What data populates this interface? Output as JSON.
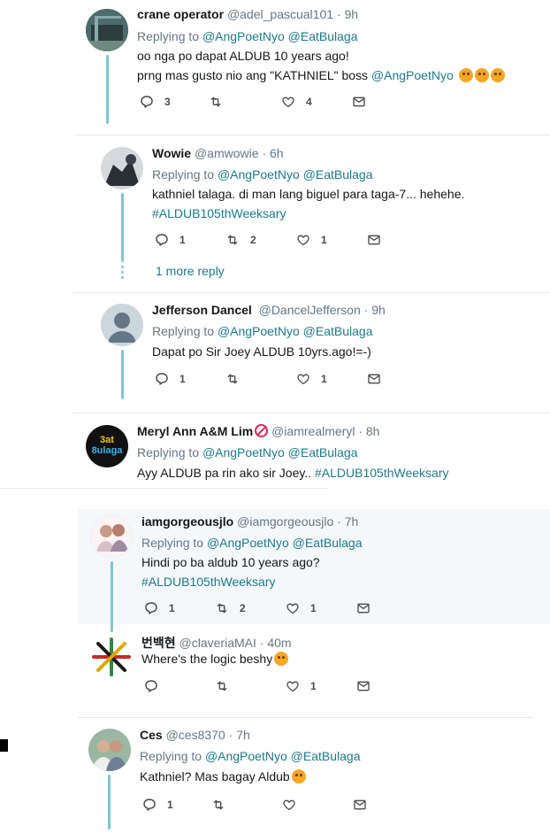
{
  "tweets": [
    {
      "name": "crane operator",
      "handle": "@adel_pascual101",
      "sep": "·",
      "time": "9h",
      "replying_prefix": "Replying to",
      "reply_to": [
        "@AngPoetNyo",
        "@EatBulaga"
      ],
      "text_lines": [
        "oo nga po dapat ALDUB 10 years ago!",
        "prng mas gusto nio ang \"KATHNIEL\" boss"
      ],
      "inline_mention": "@AngPoetNyo",
      "emojis": [
        "persevering-face",
        "persevering-face",
        "persevering-face"
      ],
      "reply_count": "3",
      "retweet_count": "",
      "like_count": "4"
    },
    {
      "name": "Wowie",
      "handle": "@amwowie",
      "sep": "·",
      "time": "6h",
      "replying_prefix": "Replying to",
      "reply_to": [
        "@AngPoetNyo",
        "@EatBulaga"
      ],
      "text_lines": [
        "kathniel talaga. di man lang biguel para taga-7... hehehe."
      ],
      "hashtag": "#ALDUB105thWeeksary",
      "reply_count": "1",
      "retweet_count": "2",
      "like_count": "1",
      "more_reply": "1 more reply"
    },
    {
      "name": "Jefferson Dancel",
      "handle": "@DancelJefferson",
      "sep": "·",
      "time": "9h",
      "replying_prefix": "Replying to",
      "reply_to": [
        "@AngPoetNyo",
        "@EatBulaga"
      ],
      "text_lines": [
        "Dapat po Sir Joey ALDUB 10yrs.ago!=-)"
      ],
      "reply_count": "1",
      "retweet_count": "",
      "like_count": "1"
    },
    {
      "name": "Meryl Ann A&M Lim",
      "handle": "@iamrealmeryl",
      "sep": "·",
      "time": "8h",
      "replying_prefix": "Replying to",
      "reply_to": [
        "@AngPoetNyo",
        "@EatBulaga"
      ],
      "text_lines": [
        "Ayy ALDUB pa rin ako sir Joey.."
      ],
      "hashtag": "#ALDUB105thWeeksary",
      "avatar_text": [
        "3at",
        "8ulaga"
      ]
    },
    {
      "name": "iamgorgeousjlo",
      "handle": "@iamgorgeousjlo",
      "sep": "·",
      "time": "7h",
      "replying_prefix": "Replying to",
      "reply_to": [
        "@AngPoetNyo",
        "@EatBulaga"
      ],
      "text_lines": [
        "Hindi po ba aldub 10 years ago?"
      ],
      "hashtag": "#ALDUB105thWeeksary",
      "reply_count": "1",
      "retweet_count": "2",
      "like_count": "1"
    },
    {
      "name": "번백현",
      "handle": "@claveriaMAI",
      "sep": "·",
      "time": "40m",
      "text_lines": [
        "Where's the logic beshy"
      ],
      "emojis": [
        "sleepy-face"
      ],
      "reply_count": "",
      "retweet_count": "",
      "like_count": "1"
    },
    {
      "name": "Ces",
      "handle": "@ces8370",
      "sep": "·",
      "time": "7h",
      "replying_prefix": "Replying to",
      "reply_to": [
        "@AngPoetNyo",
        "@EatBulaga"
      ],
      "text_lines": [
        "Kathniel? Mas bagay Aldub"
      ],
      "emojis": [
        "smiling-face"
      ],
      "reply_count": "1",
      "retweet_count": "",
      "like_count": ""
    }
  ],
  "colors": {
    "thread_line": "#7fc5d3",
    "link": "#1b7a8c",
    "muted": "#657786",
    "highlight_bg": "#f5f8fa"
  }
}
